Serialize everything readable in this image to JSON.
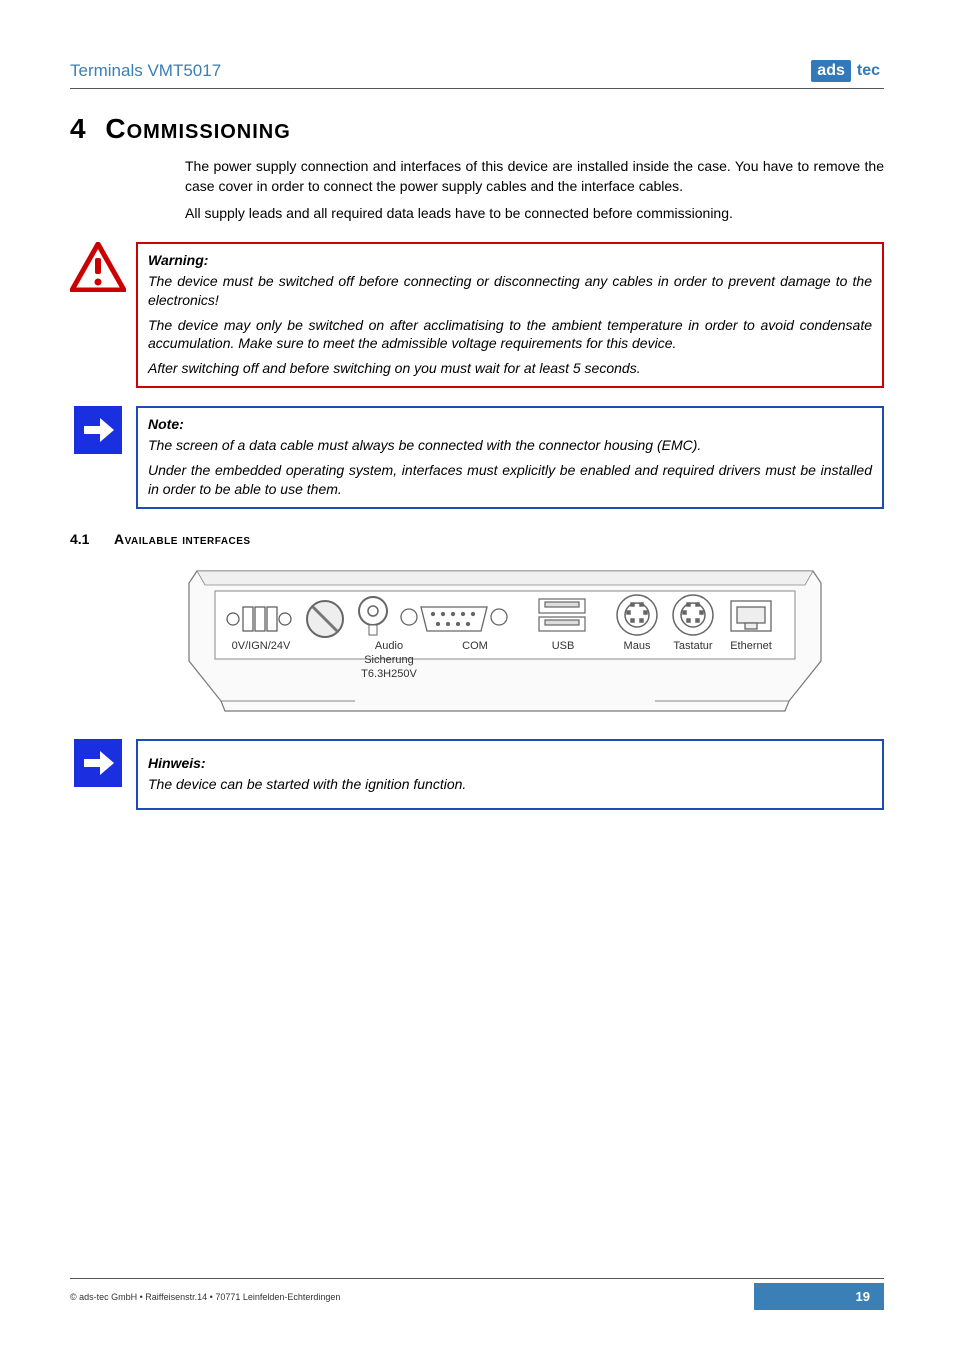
{
  "header": {
    "title": "Terminals VMT5017",
    "logo_box": "ads",
    "logo_text": "tec"
  },
  "chapter": {
    "number": "4",
    "title": "Commissioning"
  },
  "intro": {
    "p1": "The power supply connection and interfaces of this device are installed inside the case. You have to remove the case cover in order to connect the power supply cables and the interface cables.",
    "p2": "All supply leads and all required data leads have to be connected before commissioning."
  },
  "warning": {
    "title": "Warning:",
    "p1": "The device must be switched off before connecting or disconnecting any cables in order to prevent damage to the electronics!",
    "p2": "The device may only be switched on after acclimatising to the ambient temperature in order to avoid condensate accumulation. Make sure to meet the admissible voltage requirements for this device.",
    "p3": "After switching off and before switching on you must wait for at least 5 seconds."
  },
  "note": {
    "title": "Note:",
    "p1": "The screen of a data cable must always be connected with the connector housing (EMC).",
    "p2": "Under the embedded operating system, interfaces must explicitly be enabled and required drivers must be installed in order to be able to use them."
  },
  "section": {
    "number": "4.1",
    "title": "Available interfaces"
  },
  "diagram_labels": {
    "power": "0V/IGN/24V",
    "audio": "Audio",
    "fuse1": "Sicherung",
    "fuse2": "T6.3H250V",
    "com": "COM",
    "usb": "USB",
    "maus": "Maus",
    "tastatur": "Tastatur",
    "ethernet": "Ethernet"
  },
  "hinweis": {
    "title": "Hinweis:",
    "p1": "The device can be started with the ignition function."
  },
  "footer": {
    "copyright": "© ads-tec GmbH • Raiffeisenstr.14 • 70771 Leinfelden-Echterdingen",
    "page": "19"
  }
}
